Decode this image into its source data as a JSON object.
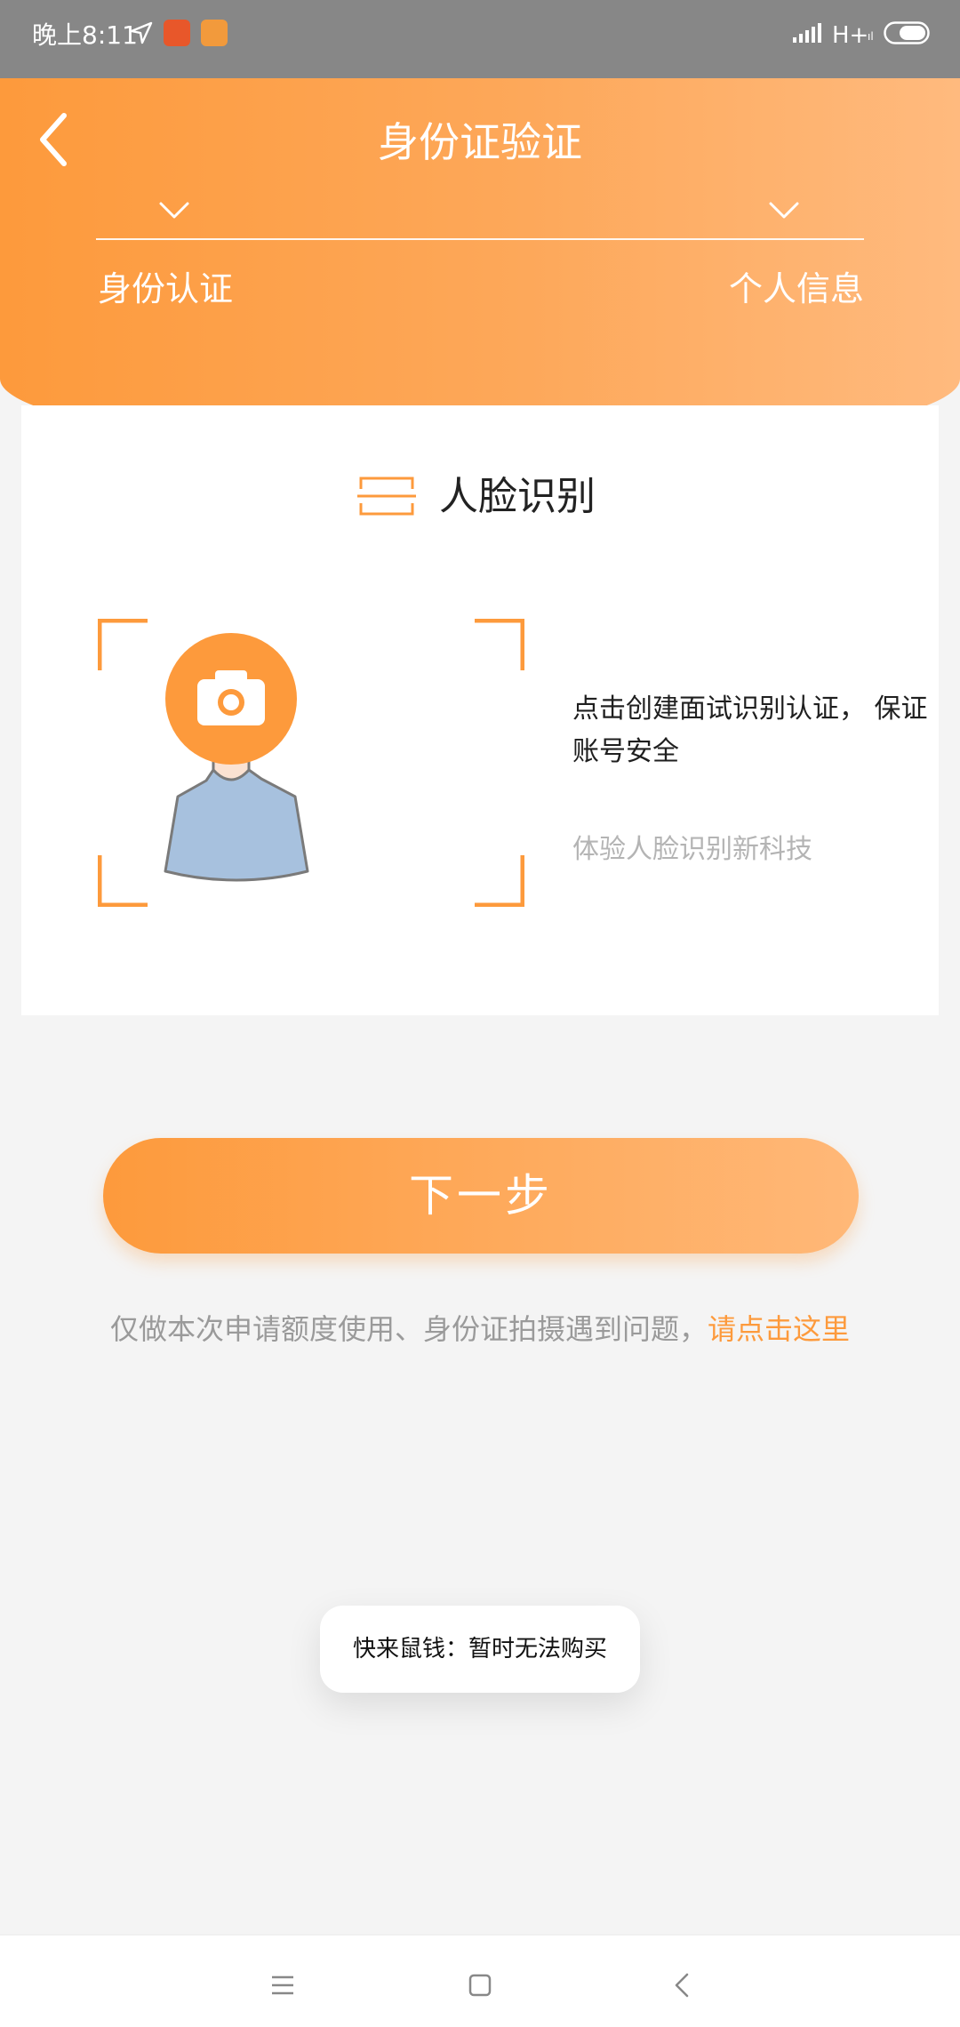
{
  "status_bar": {
    "time": "晚上8:11",
    "network": "H+",
    "network_sub": "ıl",
    "icons": [
      "location-arrow-icon",
      "app-icon-1",
      "app-icon-2",
      "signal-icon",
      "battery-icon"
    ]
  },
  "header": {
    "title": "身份证验证",
    "steps": [
      {
        "label": "身份认证"
      },
      {
        "label": "个人信息"
      }
    ]
  },
  "card": {
    "title": "人脸识别",
    "description": "点击创建面试识别认证， 保证账号安全",
    "subtext": "体验人脸识别新科技"
  },
  "next_button": {
    "label": "下一步"
  },
  "notice": {
    "text": "仅做本次申请额度使用、身份证拍摄遇到问题，",
    "link": "请点击这里"
  },
  "toast": {
    "text": "快来鼠钱：暂时无法购买"
  },
  "colors": {
    "accent": "#fd9a3c",
    "accent_light": "#ffb878",
    "status_bar": "#878787",
    "background": "#f4f4f4"
  },
  "nav_bar": {
    "icons": [
      "menu-icon",
      "home-square-icon",
      "back-chevron-icon"
    ]
  }
}
